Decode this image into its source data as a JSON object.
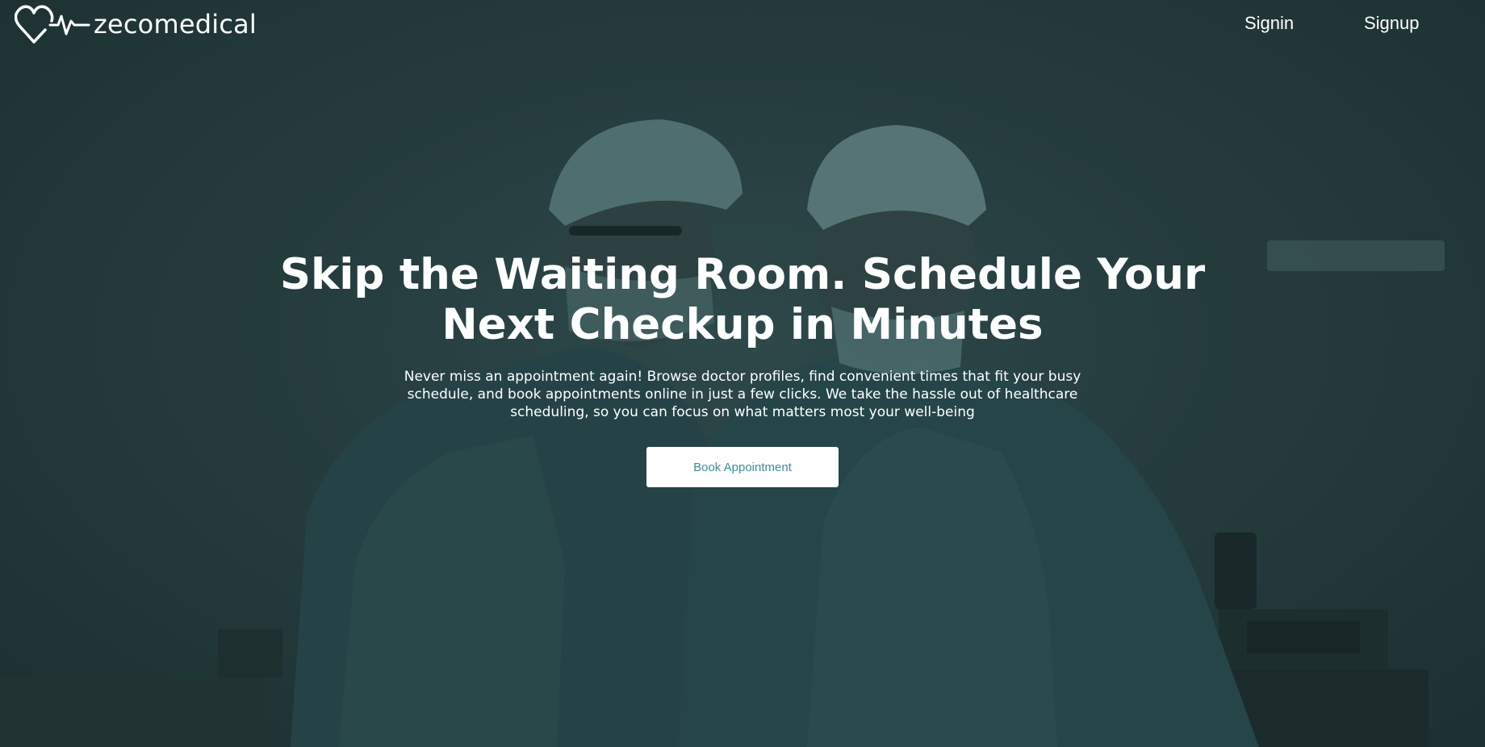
{
  "brand": {
    "name": "zecomedical",
    "logo_icon": "heart-pulse-icon"
  },
  "nav": {
    "signin_label": "Signin",
    "signup_label": "Signup"
  },
  "hero": {
    "title": "Skip the Waiting Room. Schedule Your Next Checkup in Minutes",
    "description": "Never miss an appointment again! Browse doctor profiles, find convenient times that fit your busy schedule, and book appointments online in just a few clicks. We take the hassle out of healthcare scheduling, so you can focus on what matters most your well-being",
    "cta_label": "Book Appointment",
    "background": "surgeons-in-scrubs-photo"
  },
  "colors": {
    "overlay": "#2f4a4b",
    "accent": "#3f8f95",
    "text": "#ffffff",
    "button_bg": "#ffffff"
  }
}
